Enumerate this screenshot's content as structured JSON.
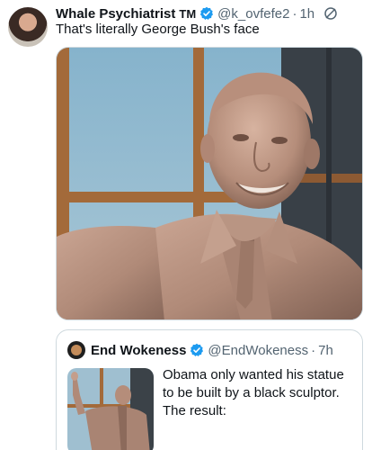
{
  "tweet": {
    "author_name": "Whale Psychiatrist",
    "author_suffix": "TM",
    "handle": "@k_ovfefe2",
    "separator": "·",
    "time": "1h",
    "text": "That's literally George Bush's face"
  },
  "quote": {
    "author_name": "End Wokeness",
    "handle": "@EndWokeness",
    "separator": "·",
    "time": "7h",
    "text": "Obama only wanted his statue to be built by a black sculptor. The result:"
  },
  "colors": {
    "verified": "#1d9bf0",
    "secondary_text": "#536471",
    "border": "#cfd9de"
  },
  "icons": {
    "verified": "verified-badge-icon",
    "mute": "muted-slash-icon"
  }
}
